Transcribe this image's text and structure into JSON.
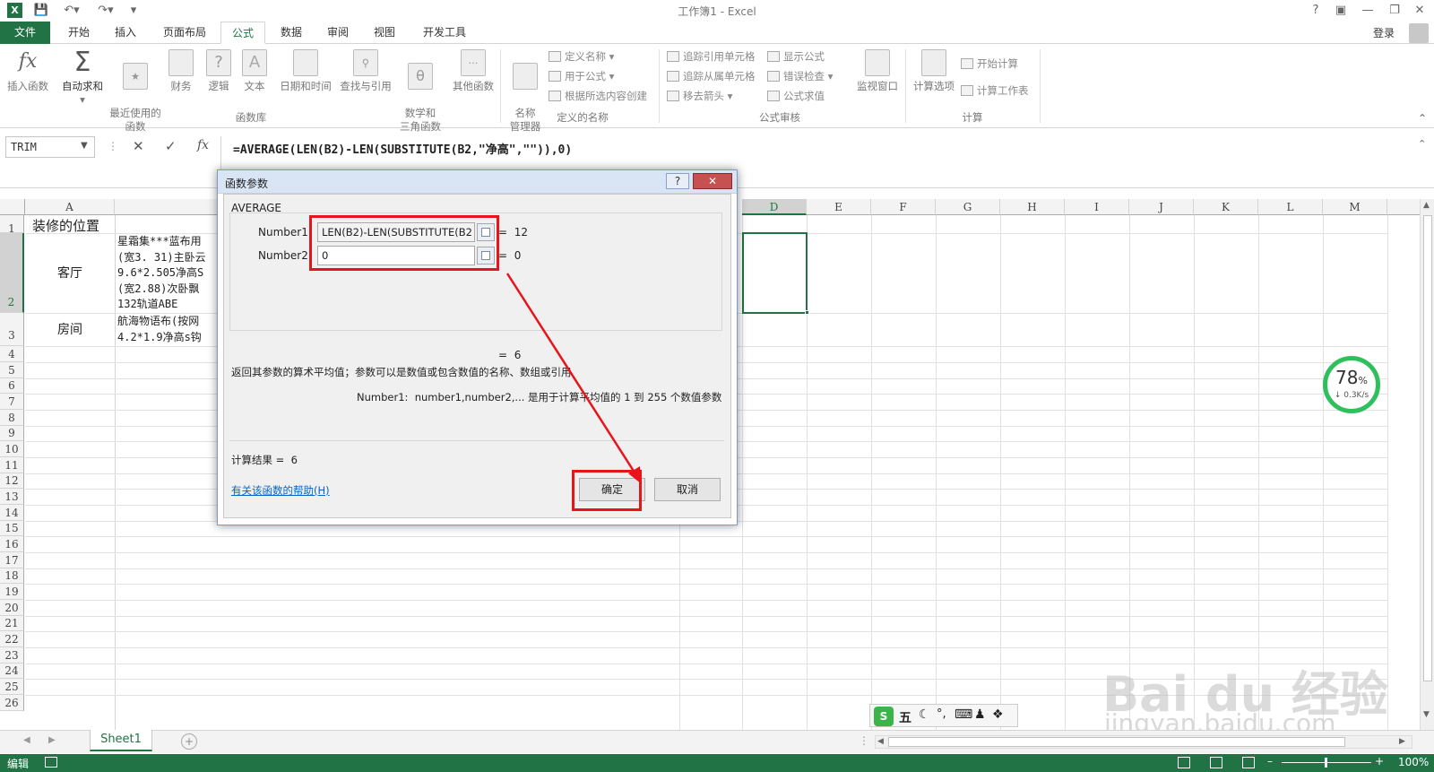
{
  "app": {
    "title": "工作簿1 - Excel",
    "login": "登录"
  },
  "tabs": [
    {
      "label": "文件"
    },
    {
      "label": "开始"
    },
    {
      "label": "插入"
    },
    {
      "label": "页面布局"
    },
    {
      "label": "公式"
    },
    {
      "label": "数据"
    },
    {
      "label": "审阅"
    },
    {
      "label": "视图"
    },
    {
      "label": "开发工具"
    }
  ],
  "ribbon": {
    "insert_function": "插入函数",
    "autosum": "自动求和",
    "recent": "最近使用的\n函数",
    "financial": "财务",
    "logical": "逻辑",
    "text": "文本",
    "datetime": "日期和时间",
    "lookup": "查找与引用",
    "math": "数学和\n三角函数",
    "more": "其他函数",
    "library_label": "函数库",
    "name_manager": "名称\n管理器",
    "define_name": "定义名称",
    "use_in_formula": "用于公式",
    "create_from_selection": "根据所选内容创建",
    "defined_names_label": "定义的名称",
    "trace_precedents": "追踪引用单元格",
    "trace_dependents": "追踪从属单元格",
    "remove_arrows": "移去箭头",
    "show_formulas": "显示公式",
    "error_checking": "错误检查",
    "evaluate_formula": "公式求值",
    "watch_window": "监视窗口",
    "auditing_label": "公式审核",
    "calc_options": "计算选项",
    "calc_now": "开始计算",
    "calc_sheet": "计算工作表",
    "calc_label": "计算"
  },
  "formula_bar": {
    "name_box": "TRIM",
    "formula": "=AVERAGE(LEN(B2)-LEN(SUBSTITUTE(B2,\"净高\",\"\")),0)"
  },
  "grid": {
    "columns": [
      "A",
      "D",
      "E",
      "F",
      "G",
      "H",
      "I",
      "J",
      "K",
      "L",
      "M"
    ],
    "rows": [
      "1",
      "2",
      "3",
      "4",
      "5",
      "6",
      "7",
      "8",
      "9",
      "10",
      "11",
      "12",
      "13",
      "14",
      "15",
      "16",
      "17",
      "18",
      "19",
      "20",
      "21",
      "22",
      "23",
      "24",
      "25",
      "26"
    ],
    "a1": "装修的位置",
    "a2": "客厅",
    "a3": "房间",
    "b2_lines": [
      "星霜集***蓝布用",
      "(宽3. 31)主卧云",
      "9.6*2.505净高S",
      "(宽2.88)次卧飘",
      "132轨道ABE"
    ],
    "b3_lines": [
      "航海物语布(按网",
      "4.2*1.9净高s钩"
    ]
  },
  "dialog": {
    "title": "函数参数",
    "function_name": "AVERAGE",
    "number1_label": "Number1",
    "number1_value": "LEN(B2)-LEN(SUBSTITUTE(B2",
    "number1_result": "12",
    "number2_label": "Number2",
    "number2_value": "0",
    "number2_result": "0",
    "overall_result": "6",
    "description": "返回其参数的算术平均值；参数可以是数值或包含数值的名称、数组或引用",
    "param_help_name": "Number1:",
    "param_help_text": "number1,number2,... 是用于计算平均值的 1 到 255 个数值参数",
    "calc_result_label": "计算结果 =",
    "calc_result_value": "6",
    "help_link": "有关该函数的帮助(H)",
    "ok": "确定",
    "cancel": "取消"
  },
  "speed_widget": {
    "percent": "78",
    "percent_sign": "%",
    "rate": "0.3K/s"
  },
  "ime_bar": {
    "wu": "五"
  },
  "sheet_tab": "Sheet1",
  "status": {
    "mode": "编辑",
    "zoom": "100%"
  },
  "watermark": {
    "brand": "Bai du 经验",
    "url": "jingyan.baidu.com"
  },
  "colors": {
    "excel_green": "#217346",
    "highlight_red": "#e8141c",
    "selection_green": "#217346"
  }
}
